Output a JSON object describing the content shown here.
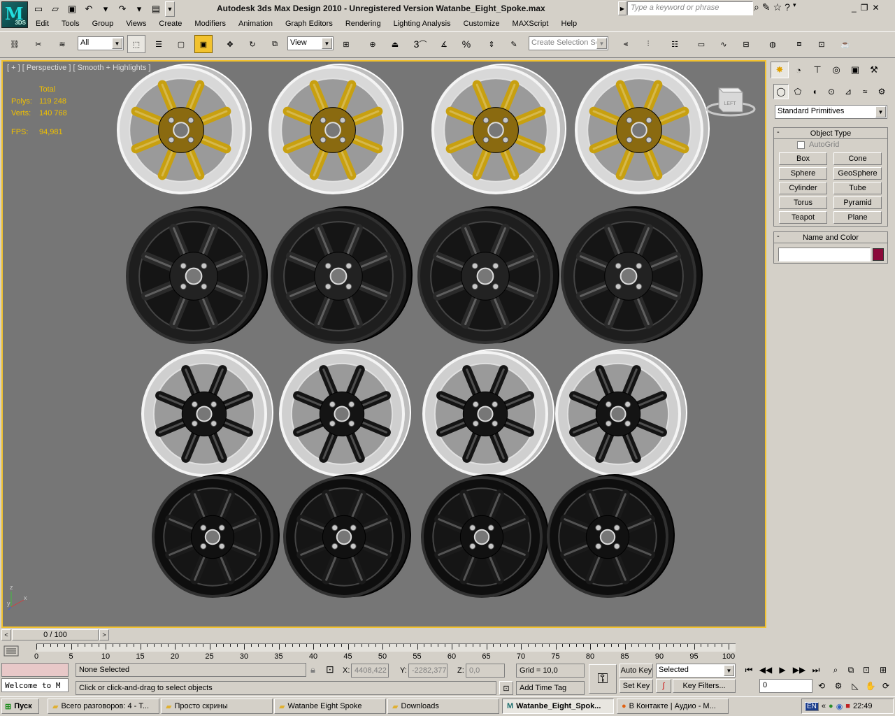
{
  "app": {
    "title": "Autodesk 3ds Max Design 2010   -   Unregistered Version    Watanbe_Eight_Spoke.max",
    "logo_label": "3DS",
    "search_placeholder": "Type a keyword or phrase"
  },
  "menu": [
    "Edit",
    "Tools",
    "Group",
    "Views",
    "Create",
    "Modifiers",
    "Animation",
    "Graph Editors",
    "Rendering",
    "Lighting Analysis",
    "Customize",
    "MAXScript",
    "Help"
  ],
  "toolbar": {
    "selection_filter": "All",
    "ref_coord": "View",
    "snap_labels": [
      "3",
      "%"
    ],
    "named_selection": "Create Selection Se"
  },
  "viewport": {
    "label": "[ + ] [ Perspective ] [ Smooth + Highlights ]",
    "stats": {
      "header": "Total",
      "polys_label": "Polys:",
      "polys": "119 248",
      "verts_label": "Verts:",
      "verts": "140 768",
      "fps_label": "FPS:",
      "fps": "94,981"
    },
    "viewcube_label": "LEFT",
    "axes": {
      "z": "z",
      "x": "x",
      "y": "y"
    },
    "wheel_rows": [
      {
        "rim_color": "#d8d8d8",
        "spoke_color": "#c8a010",
        "hub_color": "#8a6a10",
        "tire": false
      },
      {
        "rim_color": "#1e1e1e",
        "spoke_color": "#2a2a2a",
        "hub_color": "#222222",
        "tire": true
      },
      {
        "rim_color": "#cfcfcf",
        "spoke_color": "#141414",
        "hub_color": "#141414",
        "tire": false
      },
      {
        "rim_color": "#0e0e0e",
        "spoke_color": "#1a1a1a",
        "hub_color": "#111111",
        "tire": true
      }
    ]
  },
  "command_panel": {
    "category": "Standard Primitives",
    "object_type_title": "Object Type",
    "autogrid": "AutoGrid",
    "primitives": [
      "Box",
      "Cone",
      "Sphere",
      "GeoSphere",
      "Cylinder",
      "Tube",
      "Torus",
      "Pyramid",
      "Teapot",
      "Plane"
    ],
    "name_color_title": "Name and Color",
    "name_value": "",
    "object_color": "#8b0a3a"
  },
  "timeline": {
    "frame_display": "0 / 100",
    "ticks": [
      "0",
      "5",
      "10",
      "15",
      "20",
      "25",
      "30",
      "35",
      "40",
      "45",
      "50",
      "55",
      "60",
      "65",
      "70",
      "75",
      "80",
      "85",
      "90",
      "95",
      "100"
    ]
  },
  "status": {
    "maxscript_listener": "Welcome to M",
    "selection": "None Selected",
    "prompt": "Click or click-and-drag to select objects",
    "x_label": "X:",
    "x_value": "4408,422",
    "y_label": "Y:",
    "y_value": "-2282,377",
    "z_label": "Z:",
    "z_value": "0,0",
    "grid": "Grid = 10,0",
    "add_time_tag": "Add Time Tag",
    "auto_key": "Auto Key",
    "set_key": "Set Key",
    "key_mode": "Selected",
    "key_filters": "Key Filters...",
    "current_frame": "0"
  },
  "taskbar": {
    "start": "Пуск",
    "tasks": [
      {
        "label": "Всего разговоров: 4 - T...",
        "active": false
      },
      {
        "label": "Просто скрины",
        "active": false
      },
      {
        "label": "Watanbe Eight Spoke",
        "active": false
      },
      {
        "label": "Downloads",
        "active": false
      },
      {
        "label": "Watanbe_Eight_Spok...",
        "active": true
      },
      {
        "label": "В Контакте | Аудио - M...",
        "active": false
      }
    ],
    "lang": "EN",
    "clock": "22:49"
  }
}
